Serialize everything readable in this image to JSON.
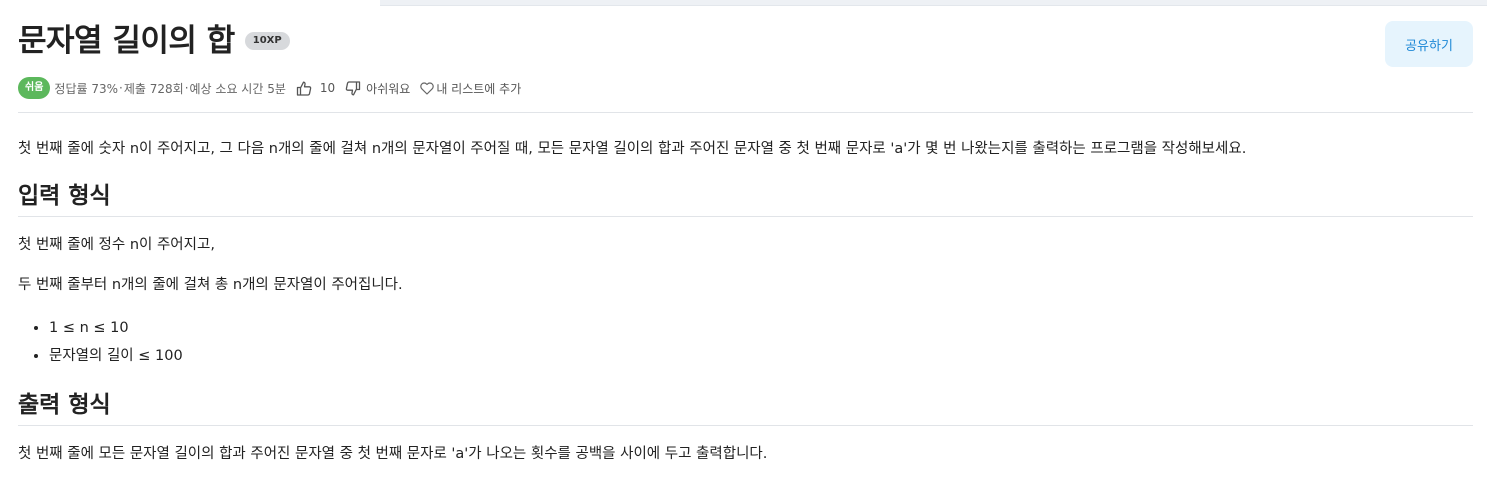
{
  "problem": {
    "title": "문자열 길이의 합",
    "xp_badge": "10XP",
    "share_label": "공유하기",
    "difficulty": "쉬움",
    "accuracy": "정답률 73%",
    "submissions": "제출 728회",
    "estimated_time": "예상 소요 시간 5분",
    "separator": "·",
    "like_count": "10",
    "dislike_label": "아쉬워요",
    "add_to_list_label": "내 리스트에 추가"
  },
  "content": {
    "intro": "첫 번째 줄에 숫자 n이 주어지고, 그 다음 n개의 줄에 걸쳐 n개의 문자열이 주어질 때, 모든 문자열 길이의 합과 주어진 문자열 중 첫 번째 문자로 'a'가 몇 번 나왔는지를 출력하는 프로그램을 작성해보세요.",
    "input_heading": "입력 형식",
    "input_line1": "첫 번째 줄에 정수 n이 주어지고,",
    "input_line2": "두 번째 줄부터 n개의 줄에 걸쳐 총 n개의 문자열이 주어집니다.",
    "constraints": [
      "1 ≤ n ≤ 10",
      "문자열의 길이 ≤ 100"
    ],
    "output_heading": "출력 형식",
    "output_line": "첫 번째 줄에 모든 문자열 길이의 합과 주어진 문자열 중 첫 번째 문자로 'a'가 나오는 횟수를 공백을 사이에 두고 출력합니다."
  },
  "icons": {
    "like": "thumbs-up-icon",
    "dislike": "thumbs-down-icon",
    "add_to_list": "heart-icon"
  },
  "colors": {
    "difficulty_badge": "#5cb85c",
    "share_button_bg": "#e6f4fd",
    "share_button_text": "#1e88d6"
  }
}
